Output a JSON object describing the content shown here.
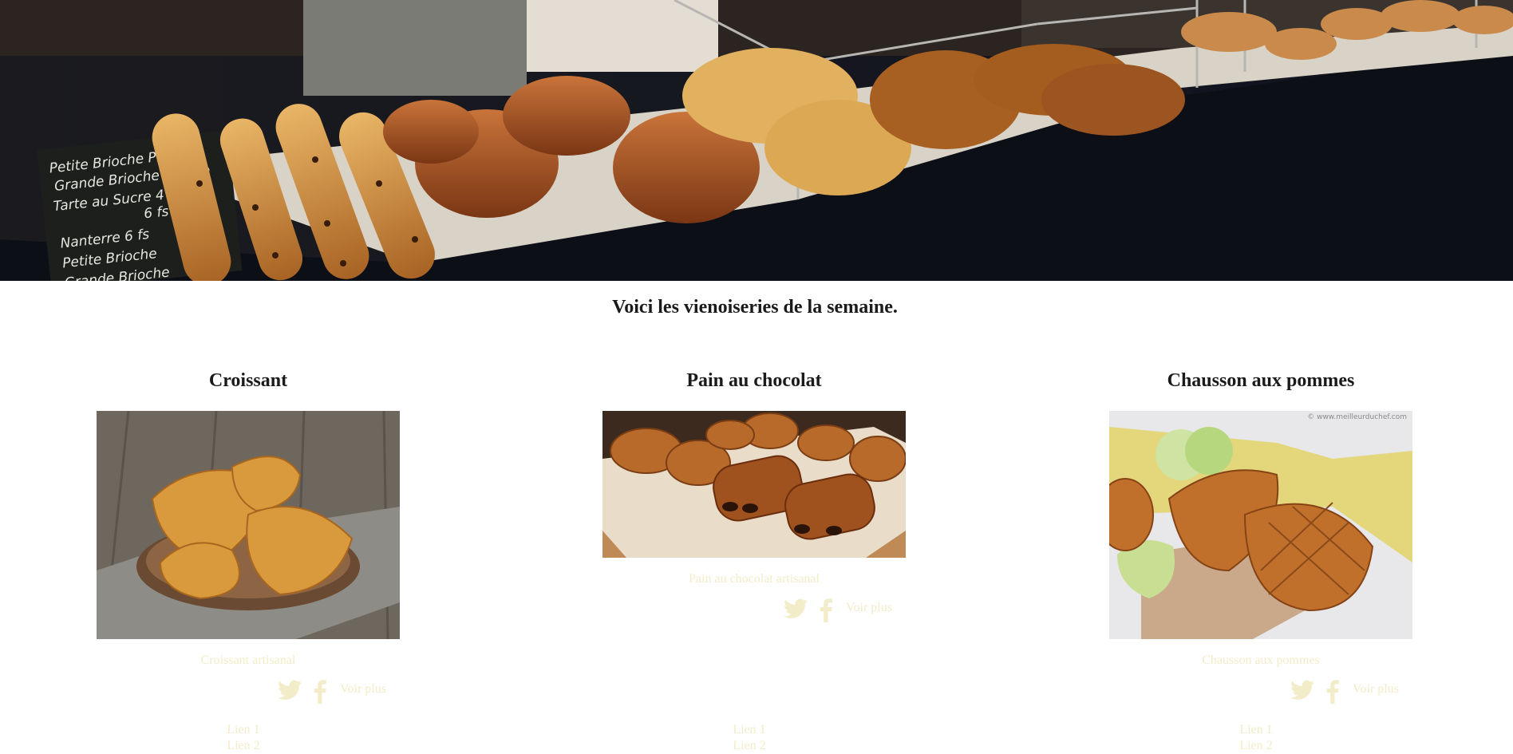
{
  "hero": {
    "chalkboard_lines": [
      "Petite Brioche Praline",
      "Grande Brioche Praline",
      "Tarte au Sucre 4 fs",
      "6 fs",
      "Nanterre 6 fs",
      "Petite Brioche",
      "Grande Brioche"
    ]
  },
  "intro": "Voici les vienoiseries de la semaine.",
  "products": [
    {
      "title": "Croissant",
      "caption": "Croissant artisanal",
      "more": "Voir plus",
      "links": [
        "Lien 1",
        "Lien 2"
      ]
    },
    {
      "title": "Pain au chocolat",
      "caption": "Pain au chocolat artisanal",
      "more": "Voir plus",
      "links": [
        "Lien 1",
        "Lien 2"
      ]
    },
    {
      "title": "Chausson aux pommes",
      "caption": "Chausson aux pommes",
      "more": "Voir plus",
      "links": [
        "Lien 1",
        "Lien 2"
      ],
      "watermark": "© www.meilleurduchef.com"
    }
  ],
  "colors": {
    "faded_text": "#f2ecc8",
    "heading": "#1a1a1a"
  }
}
